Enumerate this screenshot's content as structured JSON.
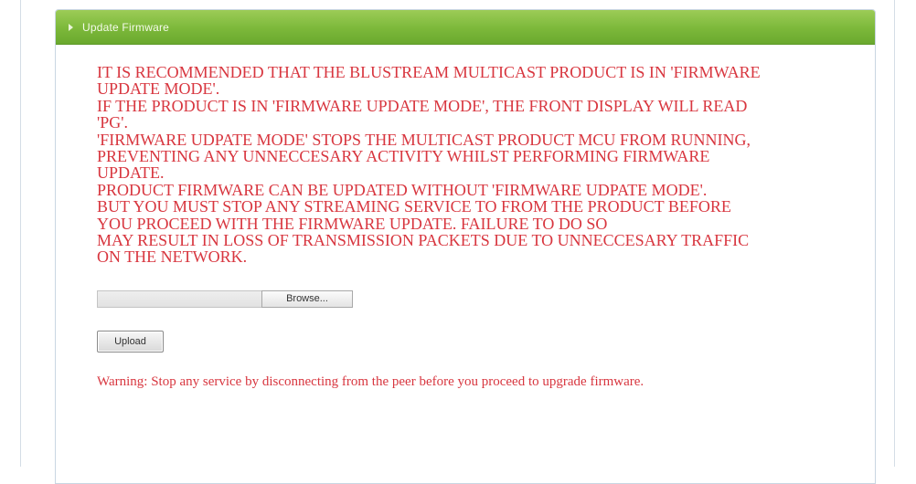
{
  "panel": {
    "title": "Update Firmware"
  },
  "notice_lines": [
    "IT IS RECOMMENDED THAT THE BLUSTREAM MULTICAST PRODUCT IS IN 'FIRMWARE",
    "UPDATE MODE'.",
    "IF THE PRODUCT IS IN 'FIRMWARE UPDATE MODE', THE FRONT DISPLAY WILL READ",
    "'PG'.",
    "'FIRMWARE UDPATE MODE' STOPS THE MULTICAST PRODUCT MCU FROM RUNNING,",
    "PREVENTING ANY UNNECCESARY ACTIVITY WHILST PERFORMING FIRMWARE",
    "UPDATE.",
    "PRODUCT FIRMWARE CAN BE UPDATED WITHOUT 'FIRMWARE UDPATE MODE'.",
    "BUT YOU MUST STOP ANY STREAMING SERVICE TO FROM THE PRODUCT BEFORE",
    "YOU PROCEED WITH THE FIRMWARE UPDATE. FAILURE TO DO SO",
    "MAY RESULT IN LOSS OF TRANSMISSION PACKETS DUE TO UNNECCESARY TRAFFIC",
    "ON THE NETWORK."
  ],
  "file_input": {
    "value": "",
    "browse_label": "Browse..."
  },
  "upload_label": "Upload",
  "warning": "Warning: Stop any service by disconnecting from the peer before you proceed to upgrade firmware.",
  "colors": {
    "header_green": "#7cb83a",
    "notice_red": "#d8363f"
  },
  "icons": {
    "header": "collapse-arrow-icon"
  }
}
